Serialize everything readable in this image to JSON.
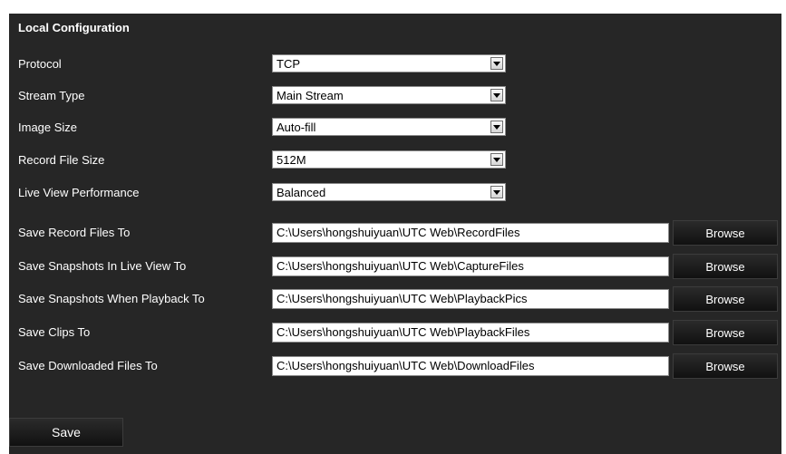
{
  "title": "Local Configuration",
  "dropdowns": [
    {
      "label": "Protocol",
      "value": "TCP"
    },
    {
      "label": "Stream Type",
      "value": "Main Stream"
    },
    {
      "label": "Image Size",
      "value": "Auto-fill"
    },
    {
      "label": "Record File Size",
      "value": "512M"
    },
    {
      "label": "Live View Performance",
      "value": "Balanced"
    }
  ],
  "paths": [
    {
      "label": "Save Record Files To",
      "value": "C:\\Users\\hongshuiyuan\\UTC Web\\RecordFiles",
      "button": "Browse"
    },
    {
      "label": "Save Snapshots In Live View To",
      "value": "C:\\Users\\hongshuiyuan\\UTC Web\\CaptureFiles",
      "button": "Browse"
    },
    {
      "label": "Save Snapshots When Playback To",
      "value": "C:\\Users\\hongshuiyuan\\UTC Web\\PlaybackPics",
      "button": "Browse"
    },
    {
      "label": "Save Clips To",
      "value": "C:\\Users\\hongshuiyuan\\UTC Web\\PlaybackFiles",
      "button": "Browse"
    },
    {
      "label": "Save Downloaded Files To",
      "value": "C:\\Users\\hongshuiyuan\\UTC Web\\DownloadFiles",
      "button": "Browse"
    }
  ],
  "save_label": "Save",
  "icons": {
    "dropdown_arrow": "chevron-down-icon"
  },
  "colors": {
    "panel_bg": "#262626",
    "text": "#ffffff"
  }
}
